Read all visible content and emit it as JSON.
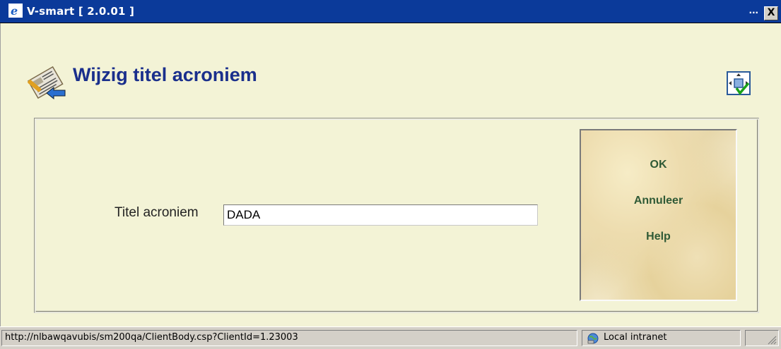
{
  "window": {
    "title": "V-smart [ 2.0.01 ]",
    "ellipsis": "...",
    "close_label": "X"
  },
  "page": {
    "title": "Wijzig titel acroniem"
  },
  "form": {
    "field_label": "Titel acroniem",
    "field_value": "DADA"
  },
  "buttons": {
    "ok": "OK",
    "cancel": "Annuleer",
    "help": "Help"
  },
  "statusbar": {
    "url": "http://nlbawqavubis/sm200qa/ClientBody.csp?ClientId=1.23003",
    "zone": "Local intranet"
  },
  "icons": {
    "app": "ie-icon",
    "page": "newspaper-edit-icon",
    "tool": "move-confirm-icon",
    "zone": "intranet-globe-icon"
  }
}
